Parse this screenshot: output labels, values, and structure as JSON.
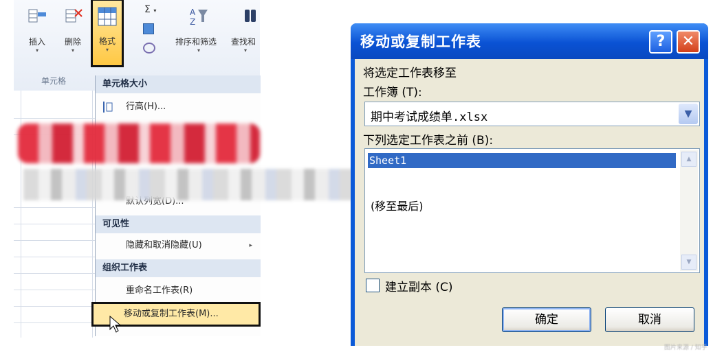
{
  "ribbon": {
    "insert_label": "插入",
    "delete_label": "删除",
    "format_label": "格式",
    "sort_filter_label": "排序和筛选",
    "find_label": "查找和",
    "group_label": "单元格",
    "sum_glyph": "Σ",
    "dropdown_glyph": "▾"
  },
  "menu": {
    "section_cell_size": "单元格大小",
    "row_height": "行高(H)...",
    "default_width": "默认列宽(D)...",
    "section_visibility": "可见性",
    "hide_unhide": "隐藏和取消隐藏(U)",
    "section_organize": "组织工作表",
    "rename_sheet": "重命名工作表(R)",
    "move_copy_sheet": "移动或复制工作表(M)...",
    "submenu_arrow": "▸"
  },
  "dialog": {
    "title": "移动或复制工作表",
    "help_glyph": "?",
    "close_glyph": "✕",
    "move_to_label": "将选定工作表移至",
    "workbook_label": "工作簿 (T):",
    "workbook_value": "期中考试成绩单.xlsx",
    "before_sheet_label": "下列选定工作表之前 (B):",
    "sheets": [
      "Sheet1",
      "(移至最后)"
    ],
    "selected_sheet_index": 0,
    "copy_label": "建立副本 (C)",
    "copy_checked": false,
    "ok_label": "确定",
    "cancel_label": "取消"
  },
  "watermark": "图片来源 / 知乎"
}
